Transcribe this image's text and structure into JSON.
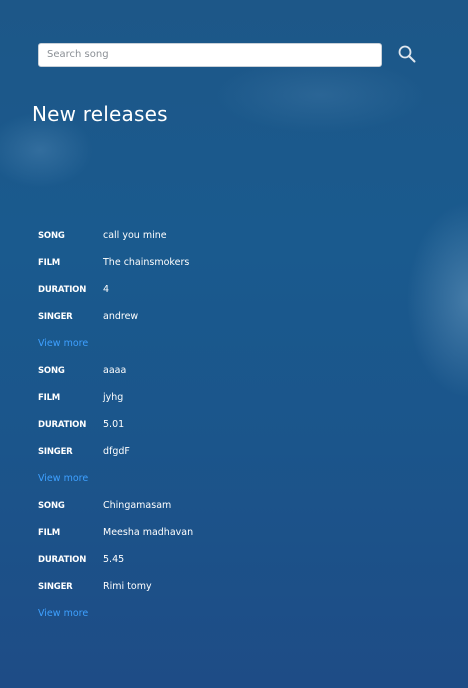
{
  "search": {
    "placeholder": "Search song",
    "value": ""
  },
  "page_title": "New releases",
  "labels": {
    "song": "SONG",
    "film": "FILM",
    "duration": "DURATION",
    "singer": "SINGER",
    "view_more": "View more"
  },
  "releases": [
    {
      "song": "call you mine",
      "film": "The chainsmokers",
      "duration": "4",
      "singer": "andrew"
    },
    {
      "song": "aaaa",
      "film": "jyhg",
      "duration": "5.01",
      "singer": "dfgdF"
    },
    {
      "song": "Chingamasam",
      "film": "Meesha madhavan",
      "duration": "5.45",
      "singer": "Rimi tomy"
    }
  ],
  "colors": {
    "background": "#1b5a8c",
    "link": "#3ea0ff",
    "text": "#ffffff"
  },
  "icons": {
    "search_button": "search-icon"
  }
}
